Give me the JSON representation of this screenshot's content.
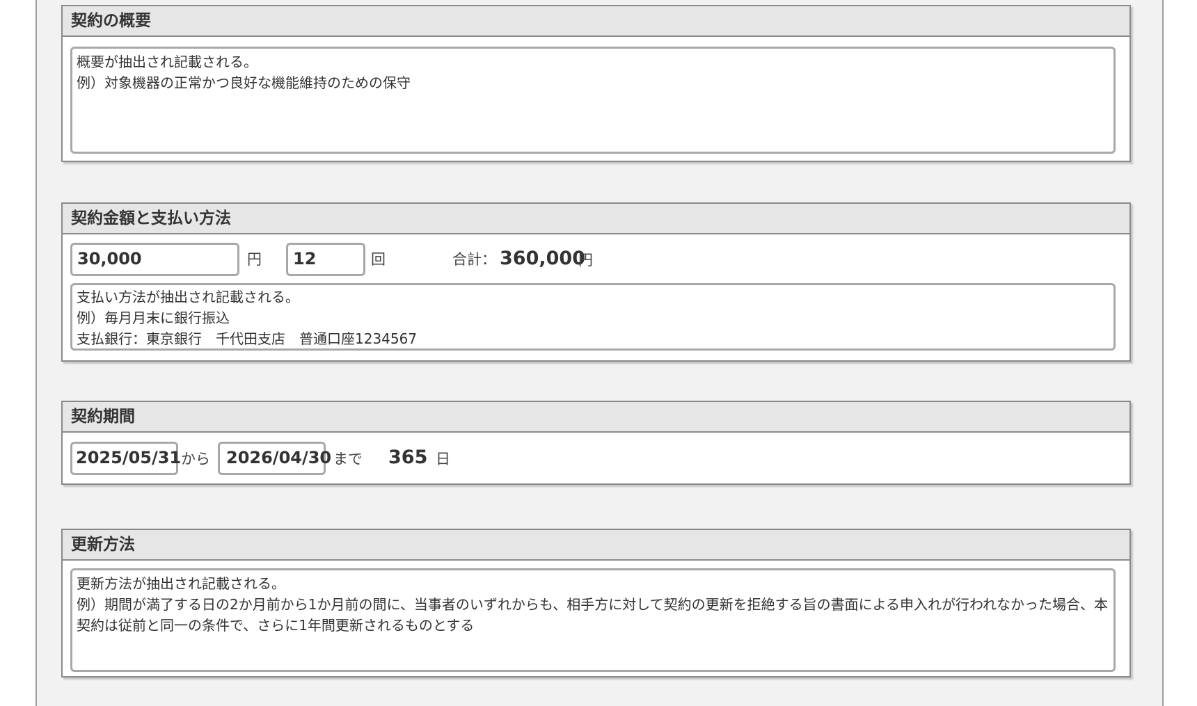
{
  "summary": {
    "title": "契約の概要",
    "text": "概要が抽出され記載される。\n例）対象機器の正常かつ良好な機能維持のための保守"
  },
  "payment": {
    "title": "契約金額と支払い方法",
    "amount": "30,000",
    "amount_unit": "円",
    "count": "12",
    "count_unit": "回",
    "total_label": "合計：",
    "total_value": "360,000",
    "total_unit": "円",
    "text": "支払い方法が抽出され記載される。\n例）毎月月末に銀行振込\n支払銀行：東京銀行　千代田支店　普通口座1234567"
  },
  "period": {
    "title": "契約期間",
    "start": "2025/05/31",
    "from_label": "から",
    "end": "2026/04/30",
    "to_label": "まで",
    "days": "365",
    "days_unit": "日"
  },
  "renewal": {
    "title": "更新方法",
    "text": "更新方法が抽出され記載される。\n例）期間が満了する日の2か月前から1か月前の間に、当事者のいずれからも、相手方に対して契約の更新を拒絶する旨の書面による申入れが行われなかった場合、本契約は従前と同一の条件で、さらに1年間更新されるものとする"
  }
}
